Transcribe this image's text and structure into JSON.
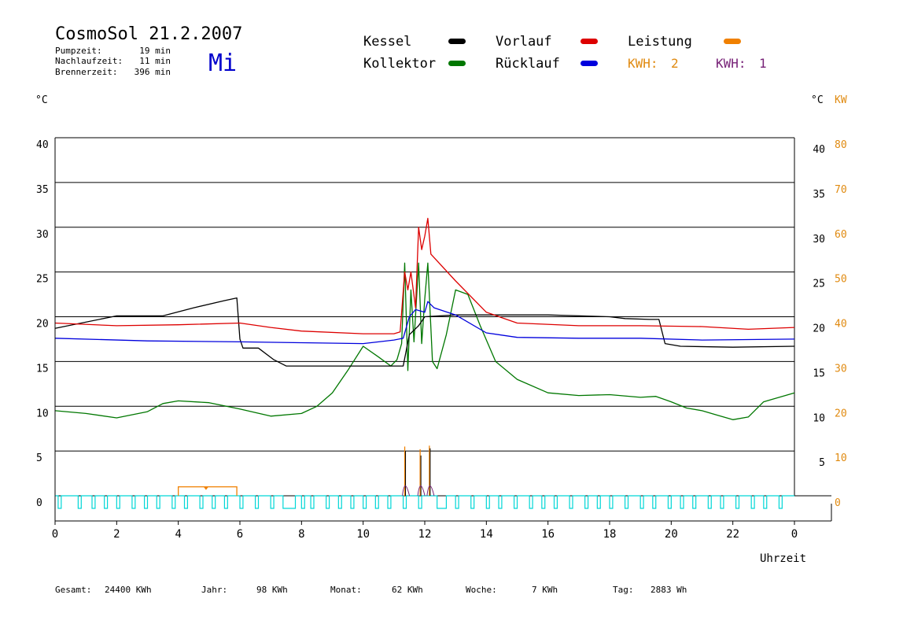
{
  "title": "CosmoSol 21.2.2007",
  "weekday": "Mi",
  "info": [
    {
      "label": "Pumpzeit:",
      "value": "19 min"
    },
    {
      "label": "Nachlaufzeit:",
      "value": "11 min"
    },
    {
      "label": "Brennerzeit:",
      "value": "396 min"
    }
  ],
  "legend": [
    {
      "label": "Kessel",
      "color": "#000000"
    },
    {
      "label": "Vorlauf",
      "color": "#dd0000"
    },
    {
      "label": "Leistung",
      "color": "#f08000",
      "label_color": "#000000"
    },
    {
      "label": "Kollektor",
      "color": "#007700"
    },
    {
      "label": "Rücklauf",
      "color": "#0000dd"
    }
  ],
  "kwh": [
    {
      "label": "KWH:",
      "value": "2",
      "color": "#e08a10"
    },
    {
      "label": "KWH:",
      "value": "1",
      "color": "#772277"
    }
  ],
  "colors": {
    "kessel": "#000000",
    "vorlauf": "#dd0000",
    "ruecklauf": "#0000dd",
    "kollektor": "#007700",
    "leistung": "#f08000",
    "pump": "#00d6d6",
    "kw_axis": "#e08a10",
    "weekday": "#0000cc",
    "kwh1": "#772277"
  },
  "footer": [
    {
      "label": "Gesamt:",
      "value": "24400 KWh"
    },
    {
      "label": "Jahr:",
      "value": "98 KWh"
    },
    {
      "label": "Monat:",
      "value": "62 KWh"
    },
    {
      "label": "Woche:",
      "value": "7 KWh"
    },
    {
      "label": "Tag:",
      "value": "2883 Wh"
    }
  ],
  "chart_data": {
    "type": "line",
    "xlabel": "Uhrzeit",
    "ylabel_left": "°C",
    "ylabel_right": "°C",
    "ylabel_right2": "KW",
    "x_ticks": [
      "0",
      "2",
      "4",
      "6",
      "8",
      "10",
      "12",
      "14",
      "16",
      "18",
      "20",
      "22",
      "0"
    ],
    "xlim": [
      0,
      24
    ],
    "ylim": [
      0,
      40
    ],
    "y_ticks_left": [
      "0",
      "5",
      "10",
      "15",
      "20",
      "25",
      "30",
      "35",
      "40"
    ],
    "y_ticks_right": [
      "",
      "5",
      "10",
      "15",
      "20",
      "25",
      "30",
      "35",
      "40"
    ],
    "y_ticks_kw": [
      "0",
      "10",
      "20",
      "30",
      "40",
      "50",
      "60",
      "70",
      "80"
    ],
    "grid": true,
    "series": [
      {
        "name": "Kessel",
        "key": "kessel",
        "points": [
          [
            0,
            18.7
          ],
          [
            2,
            20.1
          ],
          [
            3.5,
            20.1
          ],
          [
            4.5,
            21
          ],
          [
            5.5,
            21.8
          ],
          [
            5.9,
            22.1
          ],
          [
            6,
            17.5
          ],
          [
            6.1,
            16.5
          ],
          [
            6.6,
            16.5
          ],
          [
            7.1,
            15.2
          ],
          [
            7.5,
            14.5
          ],
          [
            8,
            14.5
          ],
          [
            11.3,
            14.5
          ],
          [
            11.5,
            18
          ],
          [
            11.8,
            19
          ],
          [
            12,
            20
          ],
          [
            13,
            20.2
          ],
          [
            16,
            20.2
          ],
          [
            18,
            20
          ],
          [
            18.5,
            19.8
          ],
          [
            19.3,
            19.7
          ],
          [
            19.6,
            19.7
          ],
          [
            19.8,
            17
          ],
          [
            20.3,
            16.7
          ],
          [
            22,
            16.6
          ],
          [
            24,
            16.7
          ]
        ]
      },
      {
        "name": "Vorlauf",
        "key": "vorlauf",
        "points": [
          [
            0,
            19.3
          ],
          [
            2,
            19
          ],
          [
            4,
            19.1
          ],
          [
            6,
            19.3
          ],
          [
            7,
            18.8
          ],
          [
            8,
            18.4
          ],
          [
            10,
            18.1
          ],
          [
            11,
            18.1
          ],
          [
            11.2,
            18.3
          ],
          [
            11.35,
            25
          ],
          [
            11.45,
            23
          ],
          [
            11.55,
            25
          ],
          [
            11.7,
            21
          ],
          [
            11.8,
            30
          ],
          [
            11.9,
            27.5
          ],
          [
            12,
            29
          ],
          [
            12.1,
            31
          ],
          [
            12.2,
            27
          ],
          [
            13,
            24
          ],
          [
            14,
            20.5
          ],
          [
            15,
            19.3
          ],
          [
            17,
            19
          ],
          [
            19,
            19
          ],
          [
            21,
            18.9
          ],
          [
            22.5,
            18.6
          ],
          [
            24,
            18.8
          ]
        ]
      },
      {
        "name": "Rücklauf",
        "key": "ruecklauf",
        "points": [
          [
            0,
            17.6
          ],
          [
            3,
            17.3
          ],
          [
            6,
            17.2
          ],
          [
            8,
            17.1
          ],
          [
            10,
            17
          ],
          [
            11,
            17.4
          ],
          [
            11.3,
            17.6
          ],
          [
            11.5,
            20
          ],
          [
            11.7,
            20.8
          ],
          [
            12,
            20.5
          ],
          [
            12.1,
            21.7
          ],
          [
            12.3,
            21
          ],
          [
            13,
            20.2
          ],
          [
            14,
            18.2
          ],
          [
            15,
            17.7
          ],
          [
            17,
            17.6
          ],
          [
            19,
            17.6
          ],
          [
            21,
            17.4
          ],
          [
            24,
            17.5
          ]
        ]
      },
      {
        "name": "Kollektor",
        "key": "kollektor",
        "points": [
          [
            0,
            9.5
          ],
          [
            1,
            9.2
          ],
          [
            2,
            8.7
          ],
          [
            3,
            9.4
          ],
          [
            3.5,
            10.3
          ],
          [
            4,
            10.6
          ],
          [
            5,
            10.4
          ],
          [
            6,
            9.7
          ],
          [
            7,
            8.9
          ],
          [
            8,
            9.2
          ],
          [
            8.5,
            10
          ],
          [
            9,
            11.5
          ],
          [
            9.5,
            14
          ],
          [
            10,
            16.7
          ],
          [
            10.5,
            15.5
          ],
          [
            10.9,
            14.5
          ],
          [
            11.1,
            15.2
          ],
          [
            11.25,
            17
          ],
          [
            11.35,
            26
          ],
          [
            11.45,
            14
          ],
          [
            11.55,
            23
          ],
          [
            11.65,
            17.2
          ],
          [
            11.8,
            26
          ],
          [
            11.9,
            17
          ],
          [
            12,
            22
          ],
          [
            12.1,
            26
          ],
          [
            12.25,
            15
          ],
          [
            12.4,
            14.2
          ],
          [
            12.7,
            18
          ],
          [
            13,
            23
          ],
          [
            13.4,
            22.5
          ],
          [
            13.8,
            19
          ],
          [
            14.3,
            15
          ],
          [
            15,
            13
          ],
          [
            16,
            11.5
          ],
          [
            17,
            11.2
          ],
          [
            18,
            11.3
          ],
          [
            19,
            11
          ],
          [
            19.5,
            11.1
          ],
          [
            20,
            10.5
          ],
          [
            20.5,
            9.8
          ],
          [
            21,
            9.5
          ],
          [
            21.5,
            9
          ],
          [
            22,
            8.5
          ],
          [
            22.5,
            8.8
          ],
          [
            23,
            10.5
          ],
          [
            24,
            11.5
          ]
        ]
      }
    ],
    "leistung": {
      "name": "Leistung",
      "start": 4,
      "end": 5.9,
      "kw": 2,
      "marker": 4.9
    },
    "spikes": [
      {
        "x": 11.35,
        "kessel": 5,
        "kwh": 5.5
      },
      {
        "x": 11.85,
        "kessel": 4.5,
        "kwh": 5.2
      },
      {
        "x": 12.15,
        "kessel": 5.3,
        "kwh": 5.6
      }
    ],
    "pump_on": [
      [
        0.1,
        0.2
      ],
      [
        0.75,
        0.85
      ],
      [
        1.2,
        1.3
      ],
      [
        1.6,
        1.7
      ],
      [
        2.0,
        2.1
      ],
      [
        2.5,
        2.6
      ],
      [
        2.9,
        3.0
      ],
      [
        3.3,
        3.4
      ],
      [
        3.8,
        3.9
      ],
      [
        4.2,
        4.3
      ],
      [
        4.7,
        4.8
      ],
      [
        5.1,
        5.2
      ],
      [
        5.5,
        5.6
      ],
      [
        6.0,
        6.1
      ],
      [
        6.5,
        6.6
      ],
      [
        7.0,
        7.1
      ],
      [
        7.4,
        7.8
      ],
      [
        8.0,
        8.1
      ],
      [
        8.3,
        8.4
      ],
      [
        8.8,
        8.9
      ],
      [
        9.2,
        9.3
      ],
      [
        9.6,
        9.7
      ],
      [
        10.0,
        10.1
      ],
      [
        10.4,
        10.5
      ],
      [
        10.8,
        10.9
      ],
      [
        11.3,
        11.4
      ],
      [
        11.8,
        11.9
      ],
      [
        12.4,
        12.7
      ],
      [
        13.0,
        13.1
      ],
      [
        13.5,
        13.6
      ],
      [
        14.0,
        14.1
      ],
      [
        14.4,
        14.5
      ],
      [
        14.9,
        15.0
      ],
      [
        15.4,
        15.5
      ],
      [
        15.8,
        15.9
      ],
      [
        16.2,
        16.3
      ],
      [
        16.7,
        16.8
      ],
      [
        17.2,
        17.3
      ],
      [
        17.6,
        17.7
      ],
      [
        18.0,
        18.1
      ],
      [
        18.5,
        18.6
      ],
      [
        19.0,
        19.1
      ],
      [
        19.4,
        19.5
      ],
      [
        19.9,
        20.0
      ],
      [
        20.3,
        20.4
      ],
      [
        20.7,
        20.8
      ],
      [
        21.2,
        21.3
      ],
      [
        21.6,
        21.7
      ],
      [
        22.1,
        22.2
      ],
      [
        22.6,
        22.7
      ],
      [
        23.0,
        23.1
      ],
      [
        23.5,
        23.6
      ]
    ]
  }
}
